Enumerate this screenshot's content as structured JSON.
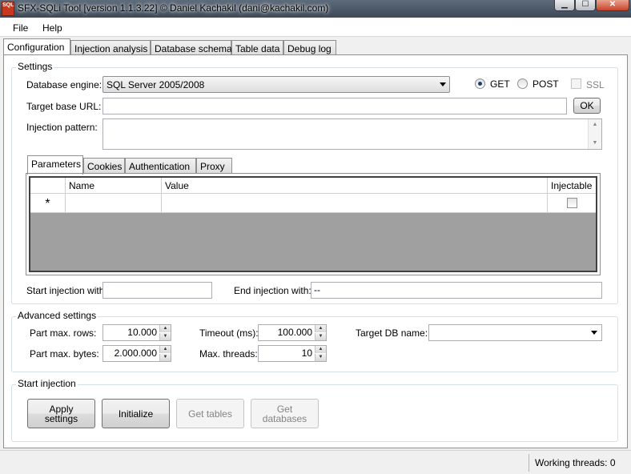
{
  "window": {
    "title": "SFX-SQLi Tool  [version 1.1.3.22]  © Daniel Kachakil (dani@kachakil.com)",
    "icon_text": "SQL",
    "controls": {
      "minimize": "▁",
      "maximize": "☐",
      "close": "✕"
    }
  },
  "menu": {
    "file": "File",
    "help": "Help"
  },
  "tabs": [
    "Configuration",
    "Injection analysis",
    "Database schema",
    "Table data",
    "Debug log"
  ],
  "settings": {
    "group_label": "Settings",
    "engine_label": "Database engine:",
    "engine_value": "SQL Server 2005/2008",
    "get_label": "GET",
    "post_label": "POST",
    "ssl_label": "SSL",
    "method_selected": "GET",
    "target_label": "Target base URL:",
    "target_value": "",
    "ok_label": "OK",
    "pattern_label": "Injection pattern:",
    "pattern_value": ""
  },
  "subtabs": [
    "Parameters",
    "Cookies",
    "Authentication",
    "Proxy"
  ],
  "grid": {
    "columns": [
      "Name",
      "Value",
      "Injectable"
    ],
    "new_row_marker": "*"
  },
  "injection_bounds": {
    "start_label": "Start injection with:",
    "start_value": "",
    "end_label": "End injection with:",
    "end_value": "--"
  },
  "advanced": {
    "group_label": "Advanced settings",
    "part_rows_label": "Part max. rows:",
    "part_rows_value": "10.000",
    "part_bytes_label": "Part max. bytes:",
    "part_bytes_value": "2.000.000",
    "timeout_label": "Timeout (ms):",
    "timeout_value": "100.000",
    "threads_label": "Max. threads:",
    "threads_value": "10",
    "target_db_label": "Target DB name:",
    "target_db_value": ""
  },
  "start": {
    "group_label": "Start injection",
    "apply_line1": "Apply",
    "apply_line2": "settings",
    "initialize": "Initialize",
    "get_tables": "Get tables",
    "get_db_line1": "Get",
    "get_db_line2": "databases"
  },
  "status": {
    "working_threads": "Working threads: 0"
  }
}
